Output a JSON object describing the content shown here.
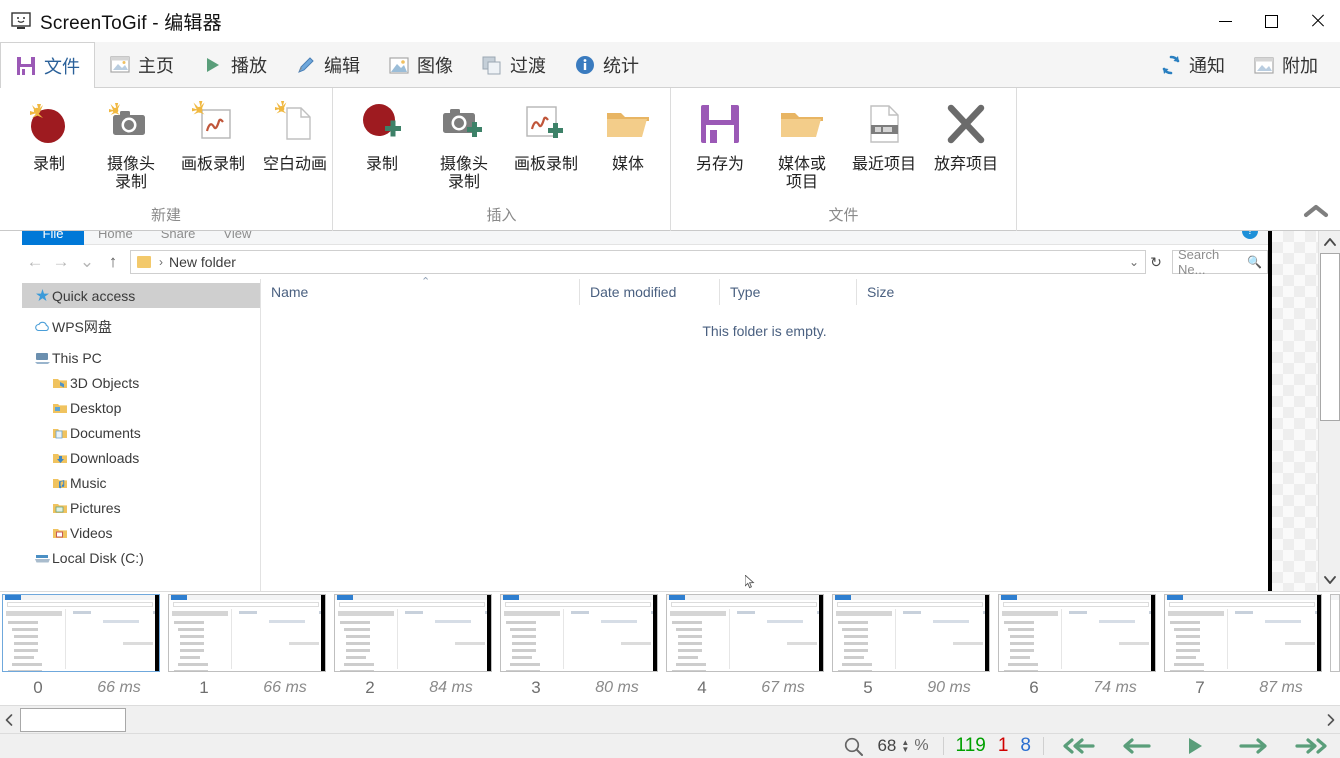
{
  "window": {
    "title": "ScreenToGif - 编辑器",
    "icon": "monitor-icon",
    "minimize": "–",
    "maximize": "□",
    "close": "✕"
  },
  "tabs": [
    {
      "label": "文件",
      "icon": "save-icon",
      "active": true
    },
    {
      "label": "主页",
      "icon": "image-icon",
      "active": false
    },
    {
      "label": "播放",
      "icon": "play-icon",
      "active": false
    },
    {
      "label": "编辑",
      "icon": "pencil-icon",
      "active": false
    },
    {
      "label": "图像",
      "icon": "picture-icon",
      "active": false
    },
    {
      "label": "过渡",
      "icon": "layers-icon",
      "active": false
    },
    {
      "label": "统计",
      "icon": "info-icon",
      "active": false
    }
  ],
  "tabs_right": [
    {
      "label": "通知",
      "icon": "refresh-icon"
    },
    {
      "label": "附加",
      "icon": "window-icon"
    }
  ],
  "ribbon": {
    "groups": [
      {
        "title": "新建",
        "items": [
          {
            "label": "录制",
            "icon": "record-new-icon"
          },
          {
            "label": "摄像头\n录制",
            "icon": "webcam-new-icon"
          },
          {
            "label": "画板录制",
            "icon": "board-new-icon"
          },
          {
            "label": "空白动画",
            "icon": "blank-page-icon"
          }
        ]
      },
      {
        "title": "插入",
        "items": [
          {
            "label": "录制",
            "icon": "record-add-icon"
          },
          {
            "label": "摄像头\n录制",
            "icon": "webcam-add-icon"
          },
          {
            "label": "画板录制",
            "icon": "board-add-icon"
          },
          {
            "label": "媒体",
            "icon": "folder-icon"
          }
        ]
      },
      {
        "title": "文件",
        "items": [
          {
            "label": "另存为",
            "icon": "floppy-save-icon"
          },
          {
            "label": "媒体或\n项目",
            "icon": "folder-open-icon"
          },
          {
            "label": "最近项目",
            "icon": "recent-file-icon"
          },
          {
            "label": "放弃项目",
            "icon": "discard-x-icon"
          }
        ]
      }
    ],
    "collapse_icon": "chevron-up-icon"
  },
  "preview": {
    "explorer": {
      "ribbon_tabs": [
        "File",
        "Home",
        "Share",
        "View"
      ],
      "help_icon": "help-icon",
      "nav": {
        "back": "←",
        "forward": "→",
        "history": "⌄",
        "up": "↑"
      },
      "address": {
        "folder_icon": "folder-icon",
        "separator": "›",
        "path": "New folder",
        "dropdown": "⌄",
        "refresh": "↻"
      },
      "search": {
        "placeholder": "Search Ne...",
        "icon": "search-icon"
      },
      "sidebar": [
        {
          "label": "Quick access",
          "icon": "star-icon",
          "selected": true,
          "indent": false
        },
        {
          "label": "WPS网盘",
          "icon": "cloud-icon",
          "selected": false,
          "indent": false
        },
        {
          "label": "This PC",
          "icon": "pc-icon",
          "selected": false,
          "indent": false
        },
        {
          "label": "3D Objects",
          "icon": "3d-folder-icon",
          "selected": false,
          "indent": true
        },
        {
          "label": "Desktop",
          "icon": "desktop-folder-icon",
          "selected": false,
          "indent": true
        },
        {
          "label": "Documents",
          "icon": "documents-folder-icon",
          "selected": false,
          "indent": true
        },
        {
          "label": "Downloads",
          "icon": "downloads-folder-icon",
          "selected": false,
          "indent": true
        },
        {
          "label": "Music",
          "icon": "music-folder-icon",
          "selected": false,
          "indent": true
        },
        {
          "label": "Pictures",
          "icon": "pictures-folder-icon",
          "selected": false,
          "indent": true
        },
        {
          "label": "Videos",
          "icon": "videos-folder-icon",
          "selected": false,
          "indent": true
        },
        {
          "label": "Local Disk (C:)",
          "icon": "disk-icon",
          "selected": false,
          "indent": false
        }
      ],
      "columns": [
        "Name",
        "Date modified",
        "Type",
        "Size"
      ],
      "empty_message": "This folder is empty.",
      "sort_indicator": "⌃"
    },
    "scrollbar": {
      "up": "⌃",
      "down": "⌄"
    }
  },
  "frames": [
    {
      "index": "0",
      "delay": "66 ms",
      "selected": true
    },
    {
      "index": "1",
      "delay": "66 ms",
      "selected": false
    },
    {
      "index": "2",
      "delay": "84 ms",
      "selected": false
    },
    {
      "index": "3",
      "delay": "80 ms",
      "selected": false
    },
    {
      "index": "4",
      "delay": "67 ms",
      "selected": false
    },
    {
      "index": "5",
      "delay": "90 ms",
      "selected": false
    },
    {
      "index": "6",
      "delay": "74 ms",
      "selected": false
    },
    {
      "index": "7",
      "delay": "87 ms",
      "selected": false
    }
  ],
  "hscroll": {
    "left_arrow": "‹",
    "right_arrow": "›"
  },
  "status": {
    "zoom_icon": "magnifier-icon",
    "zoom_value": "68",
    "spin_up": "▲",
    "spin_down": "▼",
    "percent": "%",
    "total_frames": "119",
    "current_frame": "1",
    "selected_count": "8",
    "colors": {
      "total": "#00a000",
      "current": "#d00000",
      "selected": "#2a6ed0"
    },
    "playback": [
      {
        "name": "first-frame-button",
        "icon": "skip-back-icon"
      },
      {
        "name": "previous-frame-button",
        "icon": "arrow-left-icon"
      },
      {
        "name": "play-button",
        "icon": "play-icon"
      },
      {
        "name": "next-frame-button",
        "icon": "arrow-right-icon"
      },
      {
        "name": "last-frame-button",
        "icon": "skip-forward-icon"
      }
    ]
  }
}
